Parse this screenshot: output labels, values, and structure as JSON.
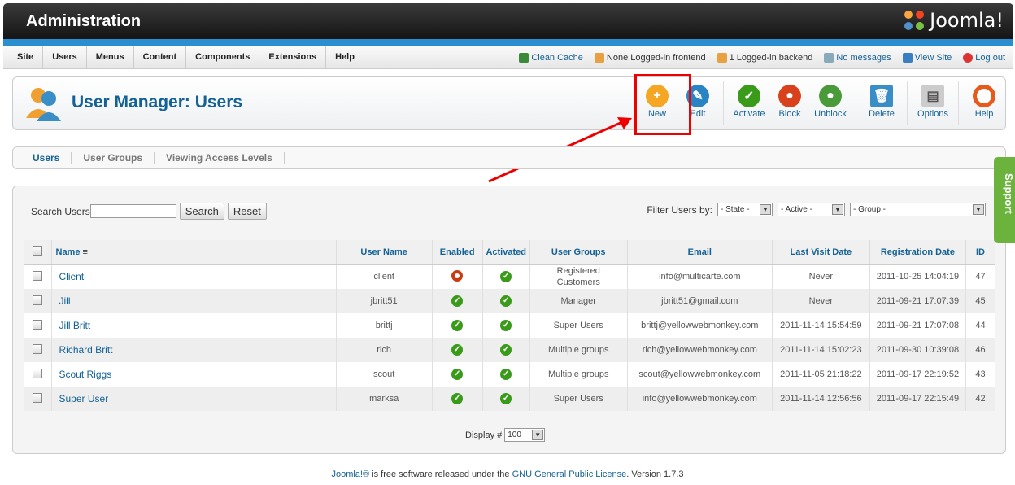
{
  "header": {
    "title": "Administration",
    "logo_text": "Joomla!"
  },
  "menu": [
    "Site",
    "Users",
    "Menus",
    "Content",
    "Components",
    "Extensions",
    "Help"
  ],
  "status": {
    "clean_cache": "Clean Cache",
    "frontend": "None Logged-in frontend",
    "backend": "1 Logged-in backend",
    "messages": "No messages",
    "view_site": "View Site",
    "logout": "Log out"
  },
  "page_title": "User Manager: Users",
  "toolbar": [
    "New",
    "Edit",
    "Activate",
    "Block",
    "Unblock",
    "Delete",
    "Options",
    "Help"
  ],
  "tabs": [
    "Users",
    "User Groups",
    "Viewing Access Levels"
  ],
  "search": {
    "label": "Search Users",
    "search_btn": "Search",
    "reset_btn": "Reset"
  },
  "filter": {
    "label": "Filter Users by:",
    "state": "- State -",
    "active": "- Active -",
    "group": "- Group -"
  },
  "columns": [
    "Name",
    "User Name",
    "Enabled",
    "Activated",
    "User Groups",
    "Email",
    "Last Visit Date",
    "Registration Date",
    "ID"
  ],
  "rows": [
    {
      "name": "Client",
      "username": "client",
      "enabled": false,
      "activated": true,
      "groups": "Registered\nCustomers",
      "email": "info@multicarte.com",
      "last": "Never",
      "reg": "2011-10-25 14:04:19",
      "id": "47"
    },
    {
      "name": "Jill",
      "username": "jbritt51",
      "enabled": true,
      "activated": true,
      "groups": "Manager",
      "email": "jbritt51@gmail.com",
      "last": "Never",
      "reg": "2011-09-21 17:07:39",
      "id": "45"
    },
    {
      "name": "Jill Britt",
      "username": "brittj",
      "enabled": true,
      "activated": true,
      "groups": "Super Users",
      "email": "brittj@yellowwebmonkey.com",
      "last": "2011-11-14 15:54:59",
      "reg": "2011-09-21 17:07:08",
      "id": "44"
    },
    {
      "name": "Richard Britt",
      "username": "rich",
      "enabled": true,
      "activated": true,
      "groups": "Multiple groups",
      "email": "rich@yellowwebmonkey.com",
      "last": "2011-11-14 15:02:23",
      "reg": "2011-09-30 10:39:08",
      "id": "46"
    },
    {
      "name": "Scout Riggs",
      "username": "scout",
      "enabled": true,
      "activated": true,
      "groups": "Multiple groups",
      "email": "scout@yellowwebmonkey.com",
      "last": "2011-11-05 21:18:22",
      "reg": "2011-09-17 22:19:52",
      "id": "43"
    },
    {
      "name": "Super User",
      "username": "marksa",
      "enabled": true,
      "activated": true,
      "groups": "Super Users",
      "email": "info@yellowwebmonkey.com",
      "last": "2011-11-14 12:56:56",
      "reg": "2011-09-17 22:15:49",
      "id": "42"
    }
  ],
  "display": {
    "label": "Display #",
    "value": "100"
  },
  "footer": {
    "joomla": "Joomla!®",
    "text": " is free software released under the ",
    "license": "GNU General Public License",
    "version": ". Version 1.7.3"
  },
  "support": "Support"
}
